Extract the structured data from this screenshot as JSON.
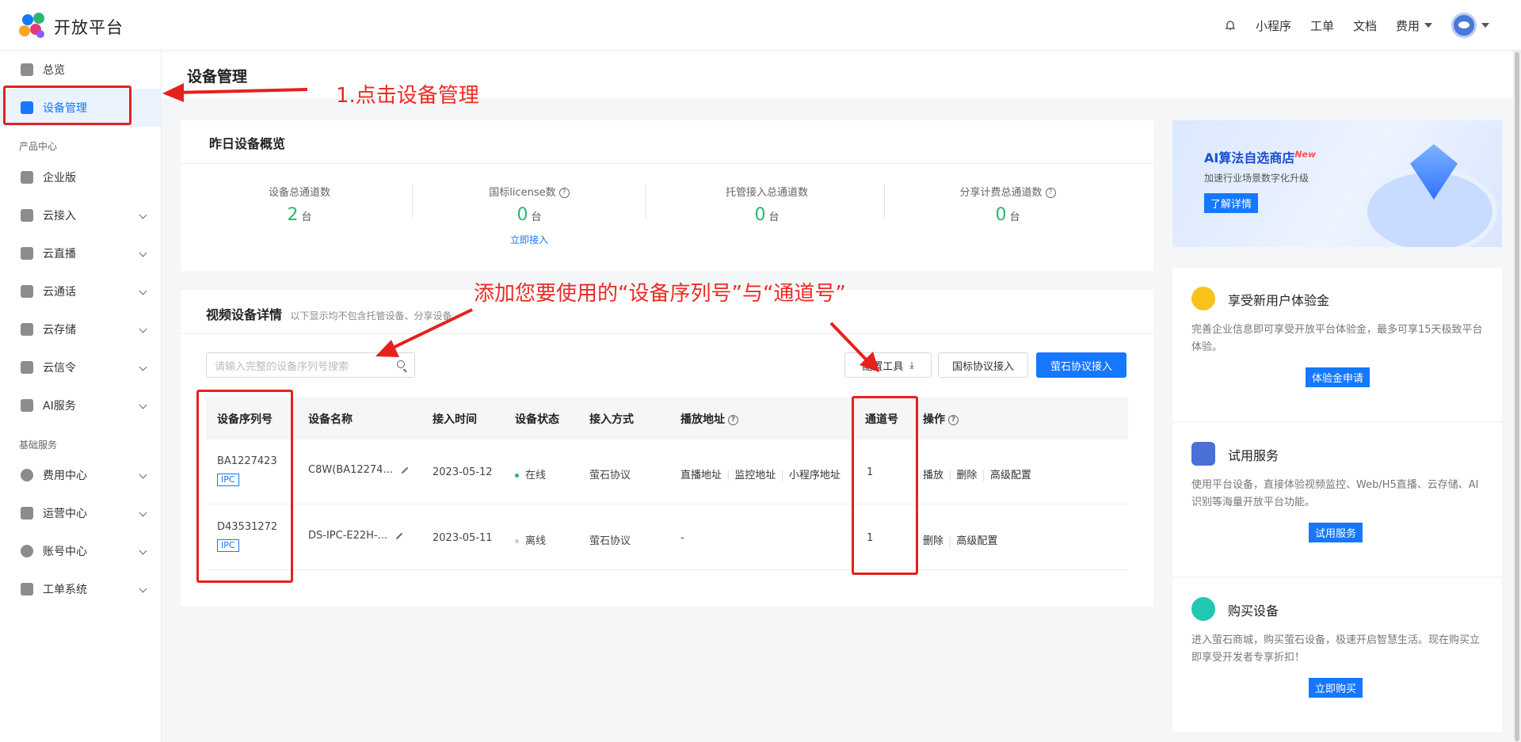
{
  "app": {
    "title": "开放平台"
  },
  "topnav": {
    "miniprogram": "小程序",
    "ticket": "工单",
    "docs": "文档",
    "fee": "费用"
  },
  "sidebar": {
    "items": [
      {
        "label": "总览"
      },
      {
        "label": "设备管理"
      },
      {
        "label": "企业版"
      },
      {
        "label": "云接入"
      },
      {
        "label": "云直播"
      },
      {
        "label": "云通话"
      },
      {
        "label": "云存储"
      },
      {
        "label": "云信令"
      },
      {
        "label": "AI服务"
      },
      {
        "label": "费用中心"
      },
      {
        "label": "运营中心"
      },
      {
        "label": "账号中心"
      },
      {
        "label": "工单系统"
      }
    ],
    "groups": [
      "产品中心",
      "基础服务"
    ]
  },
  "page": {
    "title": "设备管理"
  },
  "overview": {
    "title": "昨日设备概览",
    "stats": [
      {
        "label": "设备总通道数",
        "value": "2",
        "unit": "台"
      },
      {
        "label": "国标license数",
        "value": "0",
        "unit": "台",
        "link": "立即接入"
      },
      {
        "label": "托管接入总通道数",
        "value": "0",
        "unit": "台"
      },
      {
        "label": "分享计费总通道数",
        "value": "0",
        "unit": "台"
      }
    ]
  },
  "details": {
    "title": "视频设备详情",
    "subtitle": "以下显示均不包含托管设备、分享设备",
    "search_placeholder": "请输入完整的设备序列号搜索",
    "buttons": {
      "tool": "配置工具",
      "gb": "国标协议接入",
      "ys": "萤石协议接入"
    },
    "columns": [
      "设备序列号",
      "设备名称",
      "接入时间",
      "设备状态",
      "接入方式",
      "播放地址",
      "通道号",
      "操作"
    ],
    "rows": [
      {
        "serial": "BA1227423",
        "tag": "IPC",
        "name": "C8W(BA12274...",
        "time": "2023-05-12",
        "status": "在线",
        "status_color": "#2bb673",
        "method": "萤石协议",
        "play": [
          "直播地址",
          "监控地址",
          "小程序地址"
        ],
        "channel": "1",
        "ops": [
          "播放",
          "删除",
          "高级配置"
        ]
      },
      {
        "serial": "D43531272",
        "tag": "IPC",
        "name": "DS-IPC-E22H-...",
        "time": "2023-05-11",
        "status": "离线",
        "status_color": "#cccccc",
        "method": "萤石协议",
        "play_text": "-",
        "channel": "1",
        "ops": [
          "删除",
          "高级配置"
        ]
      }
    ]
  },
  "promo": {
    "title": "AI算法自选商店",
    "badge": "New",
    "subtitle": "加速行业场景数字化升级",
    "button": "了解详情"
  },
  "cards": [
    {
      "title": "享受新用户体验金",
      "text": "完善企业信息即可享受开放平台体验金，最多可享15天极致平台体验。",
      "button": "体验金申请",
      "color": "#f7c21c"
    },
    {
      "title": "试用服务",
      "text": "使用平台设备，直接体验视频监控、Web/H5直播、云存储、AI识别等海量开放平台功能。",
      "button": "试用服务",
      "color": "#4a6fd8"
    },
    {
      "title": "购买设备",
      "text": "进入萤石商城，购买萤石设备，极速开启智慧生活。现在购买立即享受开发者专享折扣！",
      "button": "立即购买",
      "color": "#21c7b2"
    }
  ],
  "annotations": {
    "step1": "1.点击设备管理",
    "step2": "添加您要使用的“设备序列号”与“通道号”"
  }
}
